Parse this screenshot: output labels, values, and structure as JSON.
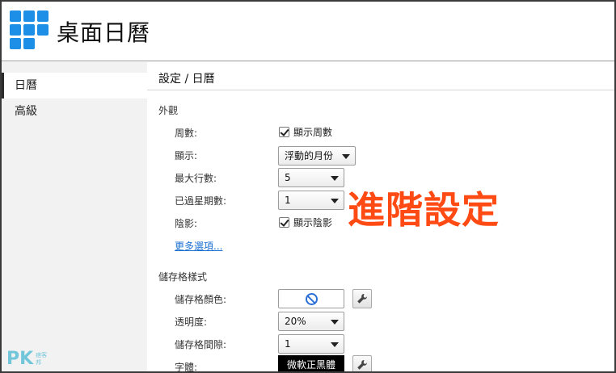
{
  "header": {
    "app_title": "桌面日曆"
  },
  "sidebar": {
    "items": [
      {
        "label": "日曆",
        "active": true
      },
      {
        "label": "高級",
        "active": false
      }
    ]
  },
  "main": {
    "breadcrumb": "設定 / 日曆",
    "appearance": {
      "section_title": "外觀",
      "week_number_label": "周數:",
      "week_number_checkbox": "顯示周數",
      "display_label": "顯示:",
      "display_value": "浮動的月份",
      "max_rows_label": "最大行數:",
      "max_rows_value": "5",
      "past_weeks_label": "已過星期數:",
      "past_weeks_value": "1",
      "shadow_label": "陰影:",
      "shadow_checkbox": "顯示陰影",
      "more_options_link": "更多選項..."
    },
    "cell_style": {
      "section_title": "儲存格樣式",
      "cell_color_label": "儲存格顏色:",
      "opacity_label": "透明度:",
      "opacity_value": "20%",
      "spacing_label": "儲存格間隙:",
      "spacing_value": "1",
      "font_label": "字體:",
      "font_value": "微軟正黑體"
    }
  },
  "overlay": {
    "annotation": "進階設定",
    "watermark_main": "PK",
    "watermark_sub1": "痞客",
    "watermark_sub2": "邦"
  },
  "icons": {
    "app_logo": "calendar-grid-icon",
    "color_none": "no-color-icon",
    "settings": "wrench-icon"
  },
  "colors": {
    "logo_blue": "#1e8fe6",
    "link_blue": "#1a6fd0",
    "annotation_orange": "#ff4a14"
  }
}
